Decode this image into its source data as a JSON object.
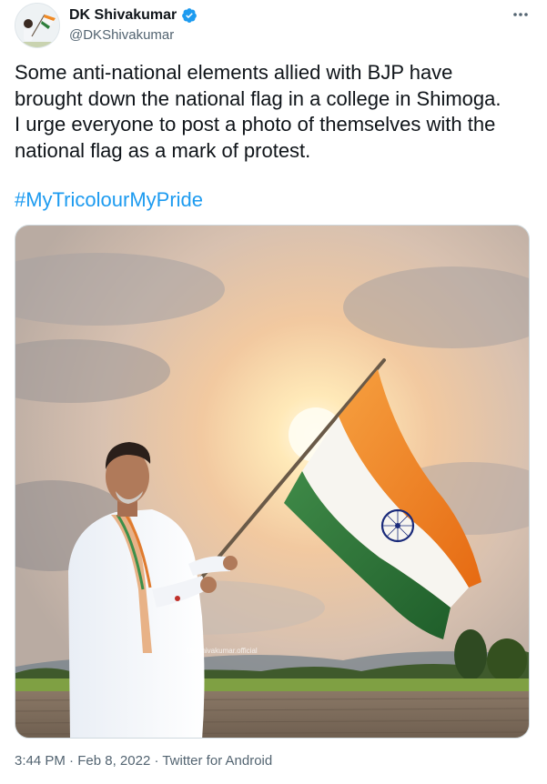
{
  "author": {
    "display_name": "DK Shivakumar",
    "handle": "@DKShivakumar",
    "verified": true
  },
  "tweet": {
    "text": "Some anti-national elements allied with BJP have\nbrought down the national flag in a college in Shimoga.\nI urge everyone to post a photo of themselves with the\nnational flag as a mark of protest.",
    "hashtag": "#MyTricolourMyPride"
  },
  "media": {
    "watermark": "DKShivakumar.official"
  },
  "meta": {
    "time": "3:44 PM",
    "separator": " · ",
    "date": "Feb 8, 2022",
    "source": "Twitter for Android"
  },
  "colors": {
    "link": "#1d9bf0",
    "secondary_text": "#536471",
    "verified_badge": "#1d9bf0",
    "saffron": "#f08a24",
    "green": "#2e7d3b",
    "chakra_blue": "#1a2a7a"
  },
  "icons": {
    "verified": "verified-badge-icon",
    "more": "more-options-icon"
  }
}
